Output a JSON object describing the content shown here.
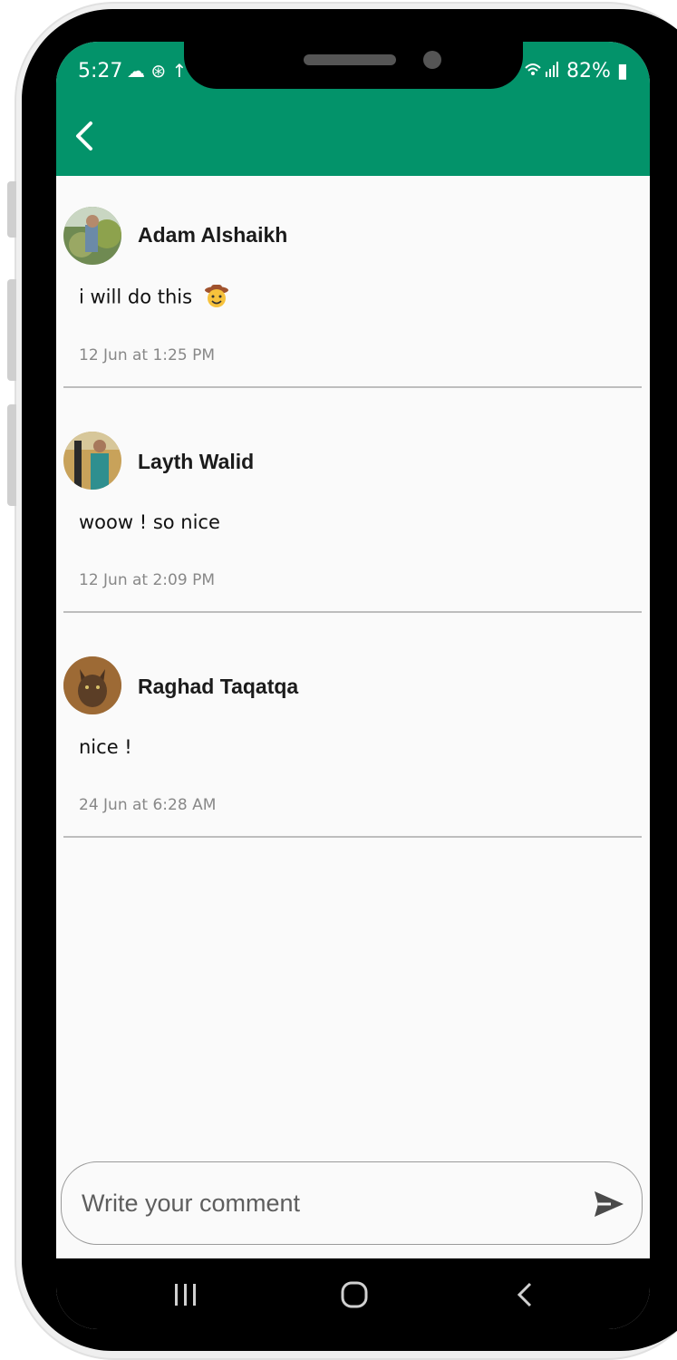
{
  "status_bar": {
    "time": "5:27",
    "left_icons": "☁ ⊛ ↑",
    "battery": "82%"
  },
  "colors": {
    "appbar": "#03936a",
    "divider": "#bdbdbd"
  },
  "comments": [
    {
      "author": "Adam Alshaikh",
      "text": "i will do this",
      "emoji": "cowboy-face",
      "time": "12 Jun at 1:25 PM"
    },
    {
      "author": "Layth Walid",
      "text": "woow ! so nice",
      "time": "12 Jun at 2:09 PM"
    },
    {
      "author": "Raghad Taqatqa",
      "text": "nice !",
      "time": "24 Jun at 6:28 AM"
    }
  ],
  "composer": {
    "placeholder": "Write your comment"
  },
  "navbar": {
    "items": [
      "recent-apps",
      "home",
      "back"
    ]
  }
}
